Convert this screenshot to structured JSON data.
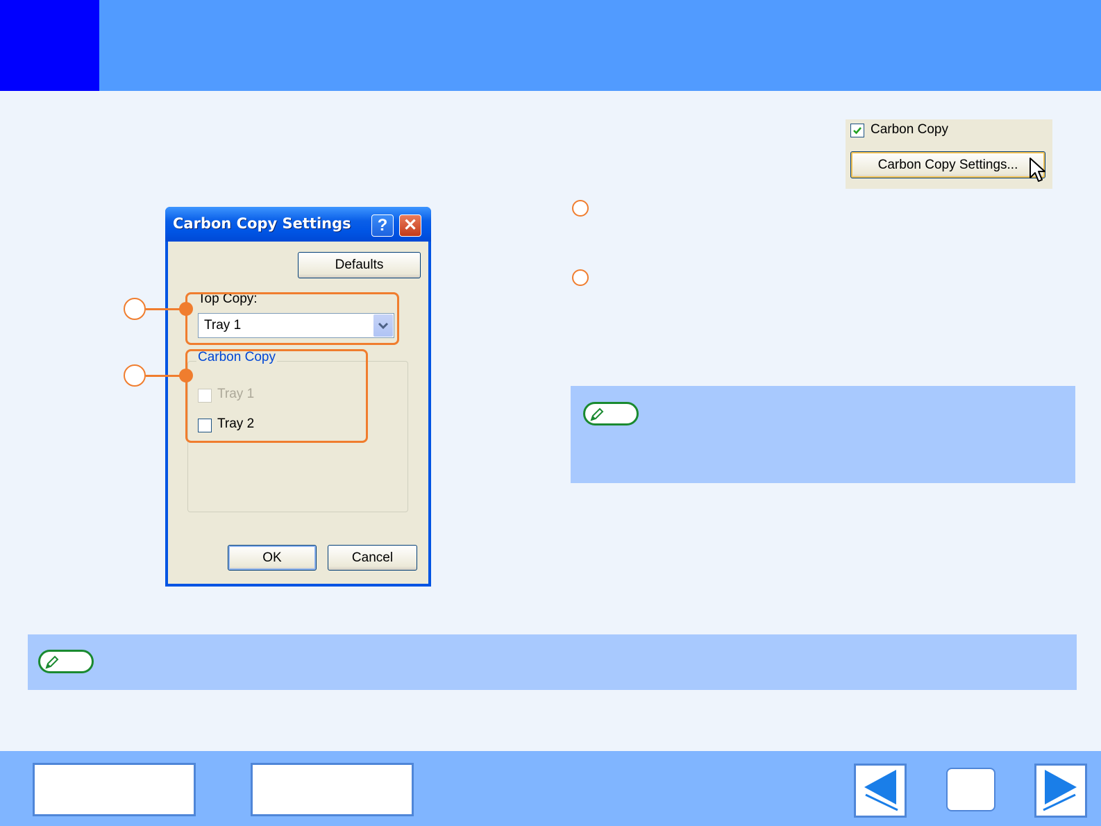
{
  "snippet": {
    "carbon_copy_checkbox_label": "Carbon Copy",
    "carbon_copy_checked": true,
    "settings_button_label": "Carbon Copy Settings..."
  },
  "dialog": {
    "title": "Carbon Copy Settings",
    "help_symbol": "?",
    "close_symbol": "✕",
    "defaults_button": "Defaults",
    "top_copy_label": "Top Copy:",
    "top_copy_value": "Tray 1",
    "carbon_copy_group": "Carbon Copy",
    "tray1_label": "Tray 1",
    "tray1_checked": false,
    "tray1_disabled": true,
    "tray2_label": "Tray 2",
    "tray2_checked": false,
    "ok_button": "OK",
    "cancel_button": "Cancel"
  },
  "colors": {
    "header": "#519bff",
    "header_block": "#0000ff",
    "callout": "#f07d2e",
    "note_background": "#a8c9fe",
    "footer": "#80b5ff"
  },
  "icons": {
    "note": "pencil-icon",
    "prev": "left-arrow-icon",
    "next": "right-arrow-icon"
  }
}
